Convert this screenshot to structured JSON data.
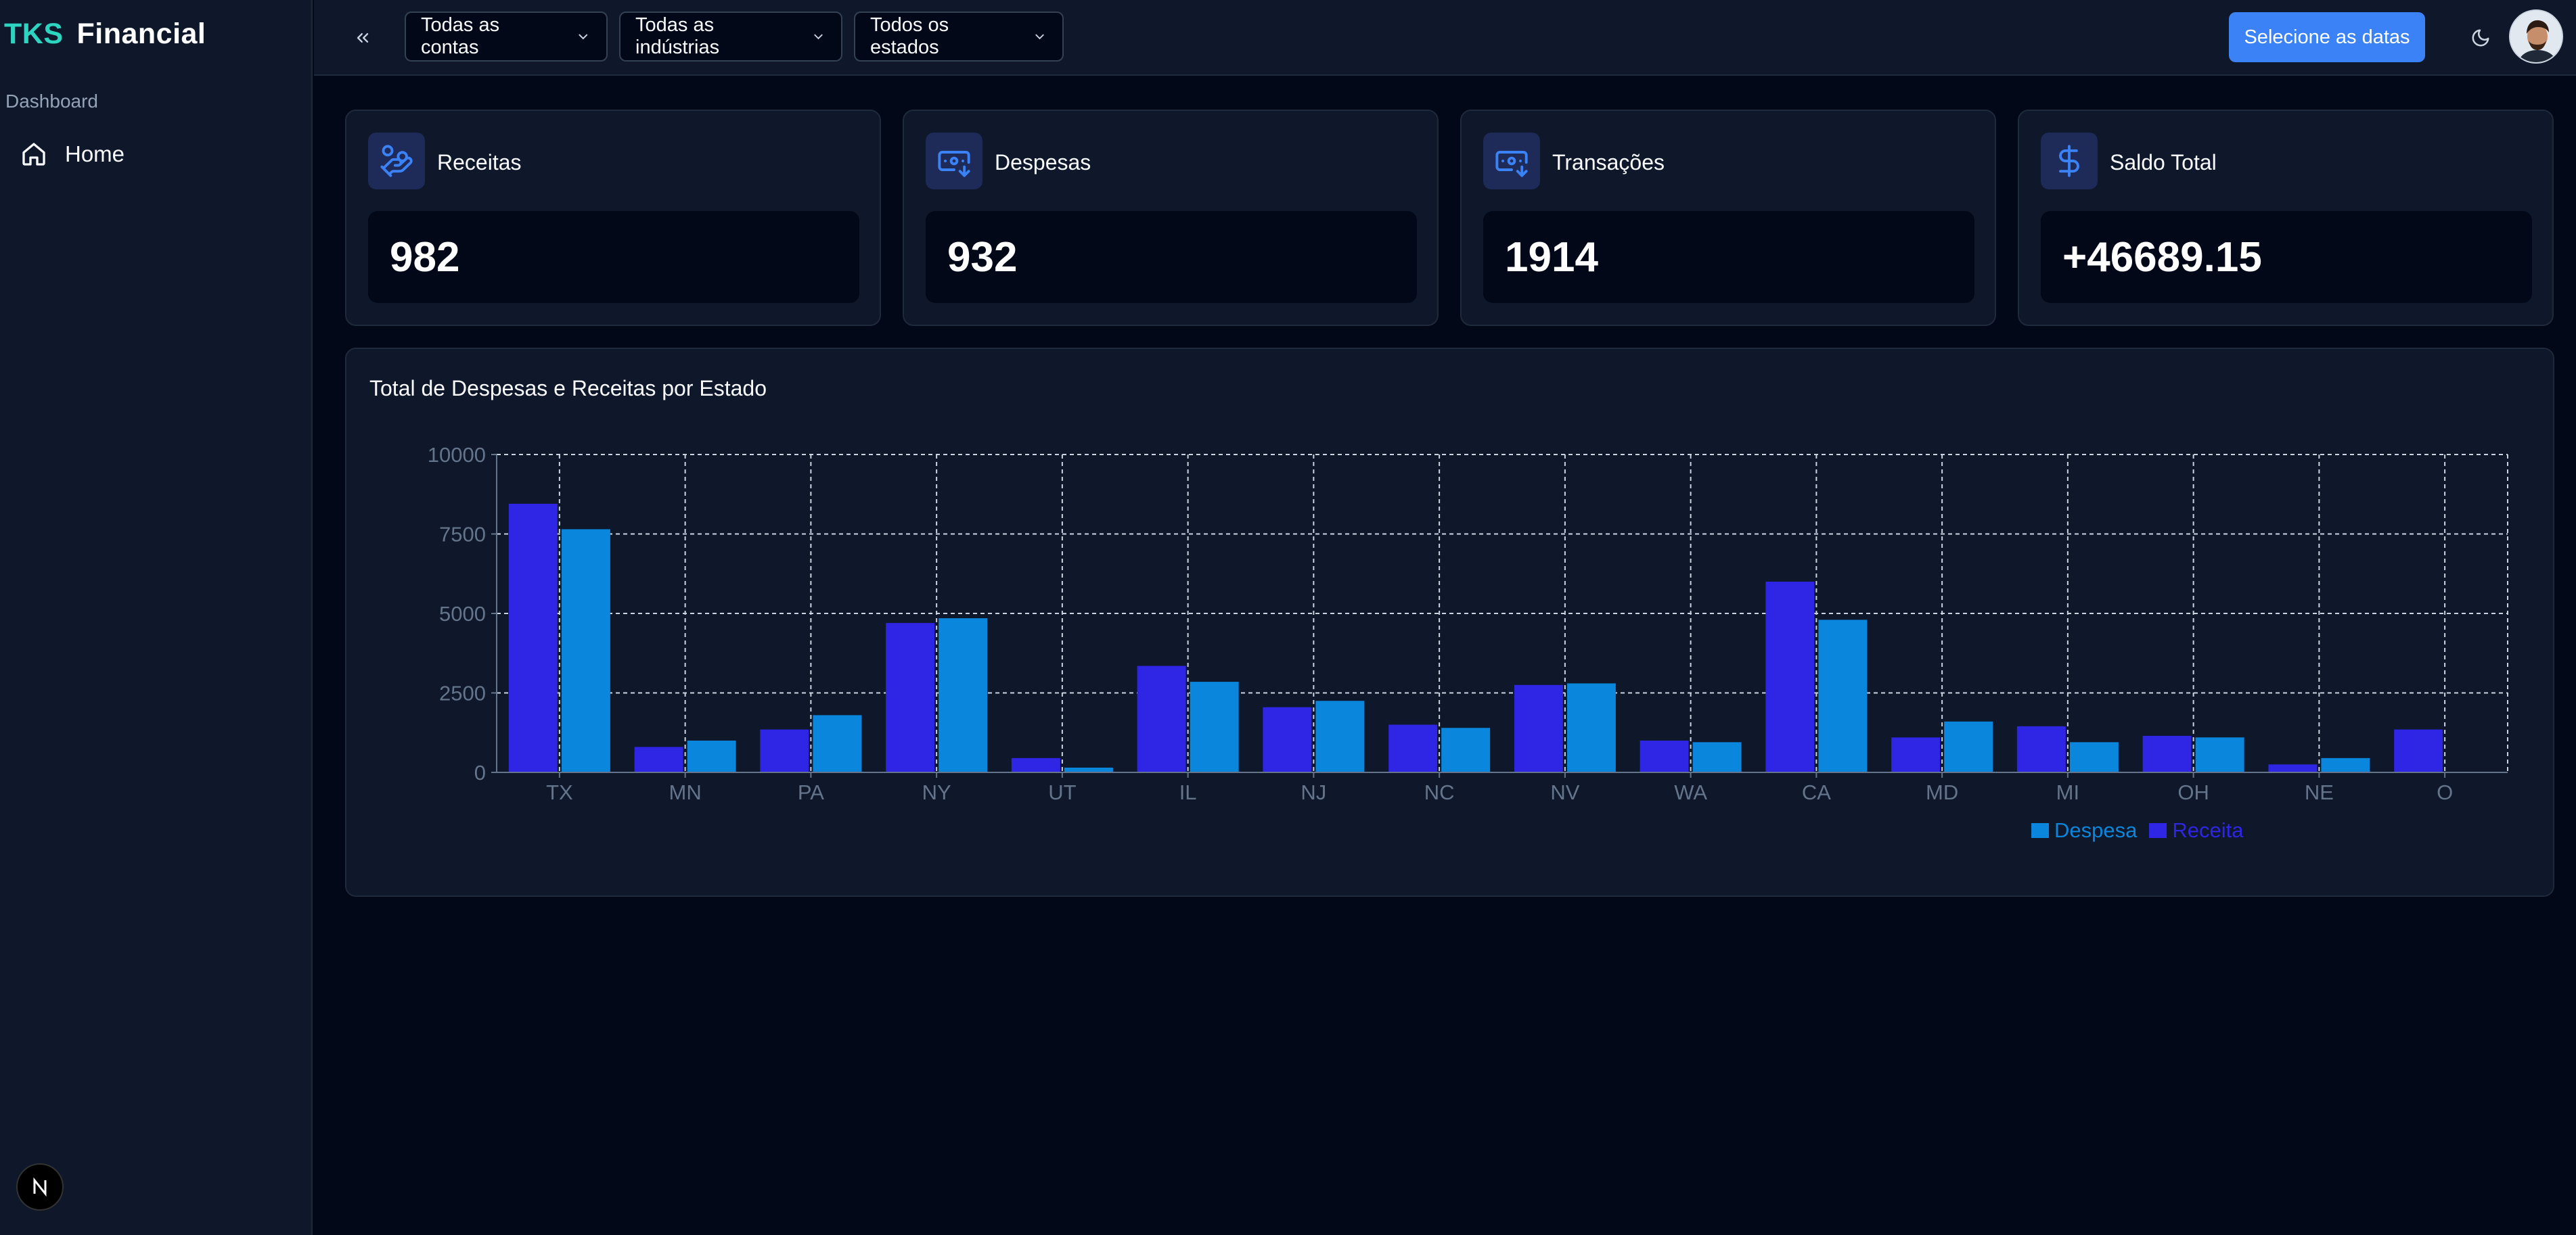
{
  "brand": {
    "part1": "TKS",
    "part2": "Financial"
  },
  "sidebar": {
    "section_label": "Dashboard",
    "items": [
      {
        "label": "Home",
        "icon": "home-icon"
      }
    ]
  },
  "topbar": {
    "filters": [
      {
        "label": "Todas as contas"
      },
      {
        "label": "Todas as indústrias"
      },
      {
        "label": "Todos os estados"
      }
    ],
    "dates_button": "Selecione as datas"
  },
  "cards": [
    {
      "title": "Receitas",
      "value": "982",
      "icon": "hand-coins-icon"
    },
    {
      "title": "Despesas",
      "value": "932",
      "icon": "banknote-arrow-down-icon"
    },
    {
      "title": "Transações",
      "value": "1914",
      "icon": "banknote-arrow-down-icon"
    },
    {
      "title": "Saldo Total",
      "value": "+46689.15",
      "icon": "dollar-sign-icon"
    }
  ],
  "colors": {
    "accent": "#3b82f6",
    "brand_teal": "#2dd4bf",
    "receita": "#2f25e4",
    "despesa": "#0a86dc"
  },
  "chart_data": {
    "type": "bar",
    "title": "Total de Despesas e Receitas por Estado",
    "categories": [
      "TX",
      "MN",
      "PA",
      "NY",
      "UT",
      "IL",
      "NJ",
      "NC",
      "NV",
      "WA",
      "CA",
      "MD",
      "MI",
      "OH",
      "NE",
      "O"
    ],
    "series": [
      {
        "name": "Receita",
        "values": [
          8450,
          800,
          1350,
          4700,
          450,
          3350,
          2050,
          1500,
          2750,
          1000,
          6000,
          1100,
          1450,
          1150,
          250,
          1350
        ]
      },
      {
        "name": "Despesa",
        "values": [
          7650,
          1000,
          1800,
          4850,
          150,
          2850,
          2250,
          1400,
          2800,
          950,
          4800,
          1600,
          950,
          1100,
          450,
          null
        ]
      }
    ],
    "yticks": [
      "0",
      "2500",
      "5000",
      "7500",
      "10000"
    ],
    "ylim": [
      0,
      10000
    ],
    "grid": true,
    "legend": [
      {
        "label": "Despesa"
      },
      {
        "label": "Receita"
      }
    ],
    "legend_position": "bottom-right"
  }
}
